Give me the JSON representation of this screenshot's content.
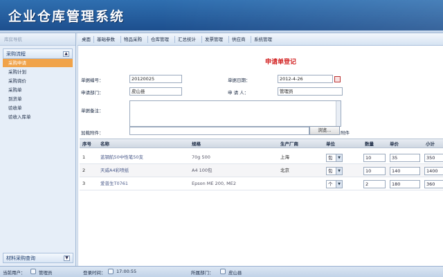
{
  "app": {
    "title": "企业仓库管理系统"
  },
  "sidebar": {
    "nav_label": "库房导航",
    "group_label": "采购流程",
    "items": [
      {
        "label": "采购申请"
      },
      {
        "label": "采购计划"
      },
      {
        "label": "采购询价"
      },
      {
        "label": "采购单"
      },
      {
        "label": "到货单"
      },
      {
        "label": "验收单"
      },
      {
        "label": "验收入库单"
      }
    ],
    "footer_group_label": "材料采购查询",
    "toggle_up": "▲",
    "toggle_down": "▼"
  },
  "topnav": {
    "items": [
      {
        "label": "桌面"
      },
      {
        "label": "基础参数"
      },
      {
        "label": "物品采购"
      },
      {
        "label": "仓库管理"
      },
      {
        "label": "汇总统计"
      },
      {
        "label": "发票管理"
      },
      {
        "label": "供应商"
      },
      {
        "label": "系统管理"
      }
    ]
  },
  "form": {
    "title": "申请单登记",
    "doc_no_label": "单据编号：",
    "doc_no_value": "20120025",
    "doc_date_label": "单据日期：",
    "doc_date_value": "2012-4-26",
    "dept_label": "申请部门：",
    "dept_value": "皮山县",
    "applicant_label": "申 请 人：",
    "applicant_value": "管理员",
    "remark_label": "单据备注：",
    "attach_label": "加载附件：",
    "browse_label": "浏览...",
    "attach_suffix": "附件"
  },
  "table": {
    "headers": [
      "序号",
      "名称",
      "规格",
      "生产厂商",
      "单位",
      "数量",
      "单价",
      "小计"
    ],
    "rows": [
      {
        "no": "1",
        "name": "蓝钢航50中性笔50支",
        "spec": "70g 500",
        "maker": "上海",
        "unit": "包",
        "qty": "10",
        "price": "35",
        "subtotal": "350"
      },
      {
        "no": "2",
        "name": "天威A4彩喷纸",
        "spec": "A4 100包",
        "maker": "北京",
        "unit": "包",
        "qty": "10",
        "price": "140",
        "subtotal": "1400"
      },
      {
        "no": "3",
        "name": "爱普生T0761",
        "spec": "Epson ME 200, ME2",
        "maker": "",
        "unit": "个",
        "qty": "2",
        "price": "180",
        "subtotal": "360"
      }
    ]
  },
  "statusbar": {
    "user_label": "当前用户：",
    "user_value": "管理员",
    "time_label": "登录时间：",
    "time_value": "17:00:55",
    "dept_label": "所属部门：",
    "dept_value": "皮山县"
  }
}
